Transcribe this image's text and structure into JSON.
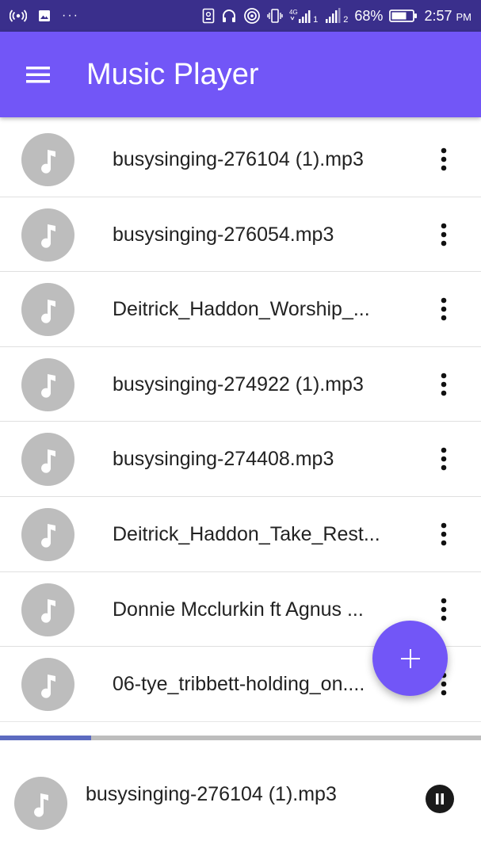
{
  "status_bar": {
    "battery_percent": "68%",
    "time": "2:57",
    "time_suffix": "PM",
    "network_label": "4G",
    "sim1": "1",
    "sim2": "2",
    "dots": "···"
  },
  "app_bar": {
    "title": "Music Player"
  },
  "songs": [
    {
      "title": "busysinging-276104 (1).mp3"
    },
    {
      "title": "busysinging-276054.mp3"
    },
    {
      "title": "Deitrick_Haddon_Worship_..."
    },
    {
      "title": "busysinging-274922 (1).mp3"
    },
    {
      "title": "busysinging-274408.mp3"
    },
    {
      "title": "Deitrick_Haddon_Take_Rest..."
    },
    {
      "title": "Donnie Mcclurkin ft Agnus ..."
    },
    {
      "title": "06-tye_tribbett-holding_on...."
    }
  ],
  "player": {
    "progress": 0.19,
    "now_playing_title": "busysinging-276104 (1).mp3"
  },
  "colors": {
    "status_bar": "#3a2f8c",
    "app_bar": "#7256f7",
    "fab": "#7256f7",
    "progress_fill": "#5c6bc0",
    "progress_track": "#bdbdbd",
    "avatar": "#bdbdbd"
  },
  "icons": {
    "menu": "hamburger-icon",
    "song": "music-note-icon",
    "more": "more-vertical-icon",
    "fab": "plus-icon",
    "pause": "pause-icon"
  }
}
